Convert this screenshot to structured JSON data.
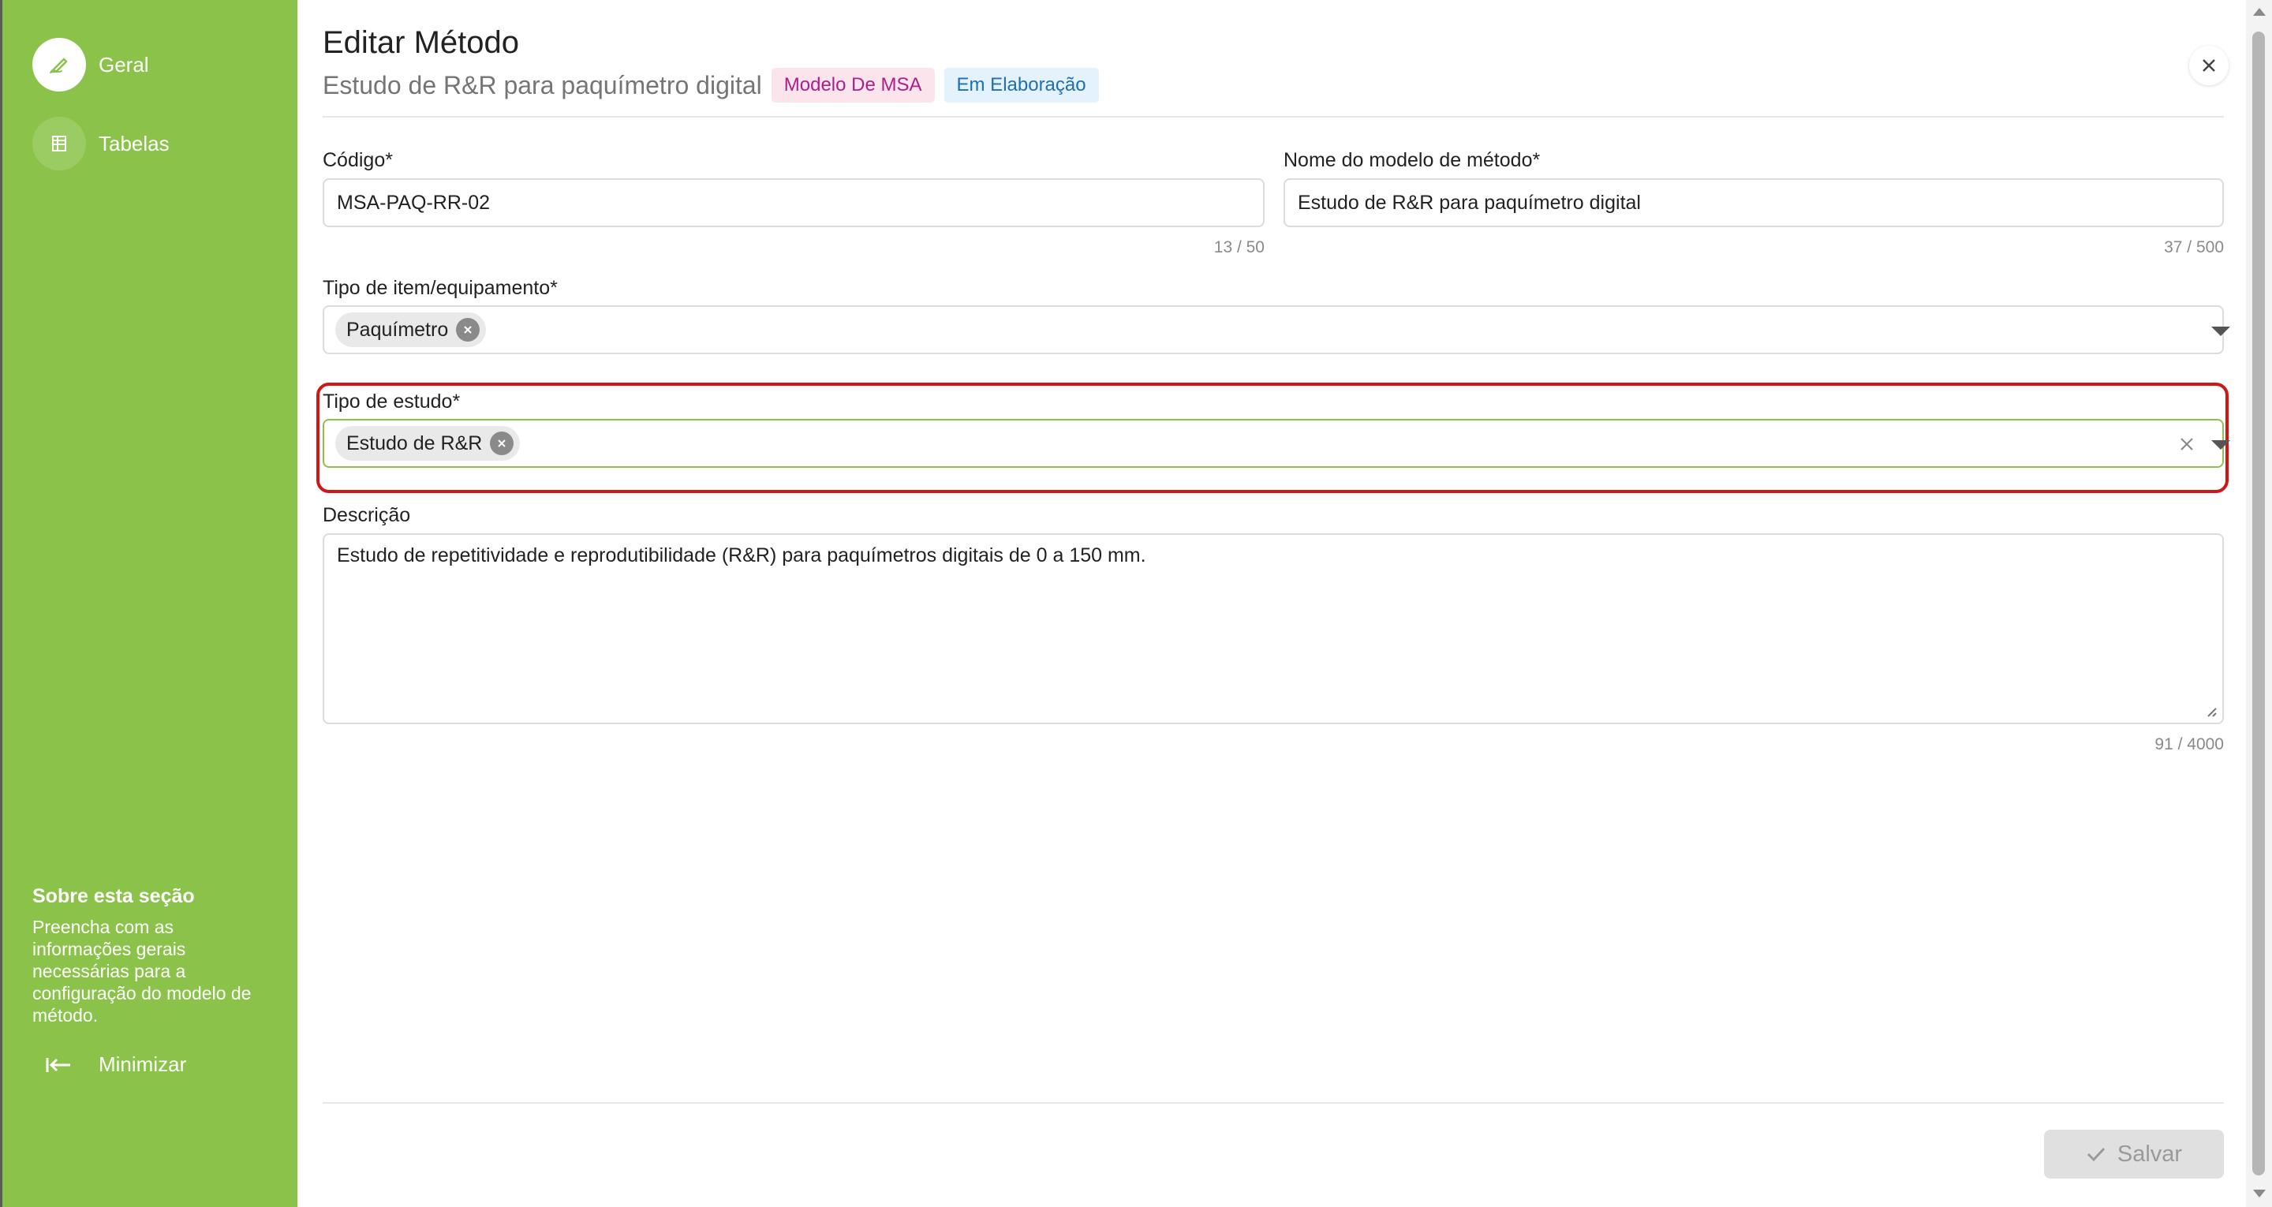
{
  "sidebar": {
    "items": [
      {
        "label": "Geral",
        "icon": "pencil-icon",
        "active": true
      },
      {
        "label": "Tabelas",
        "icon": "table-icon",
        "active": false
      }
    ],
    "about_title": "Sobre esta seção",
    "about_text": "Preencha com as informações gerais necessárias para a configuração do modelo de método.",
    "minimize_label": "Minimizar"
  },
  "header": {
    "title": "Editar Método",
    "subtitle": "Estudo de R&R para paquímetro digital",
    "badges": [
      {
        "label": "Modelo De MSA",
        "color": "#ad1f8a"
      },
      {
        "label": "Em Elaboração",
        "color": "#1f6fb2"
      }
    ]
  },
  "form": {
    "codigo": {
      "label": "Código*",
      "value": "MSA-PAQ-RR-02",
      "counter": "13 / 50"
    },
    "nome": {
      "label": "Nome do modelo de método*",
      "value": "Estudo de R&R para paquímetro digital",
      "counter": "37 / 500"
    },
    "tipo_item": {
      "label": "Tipo de item/equipamento*",
      "chip": "Paquímetro"
    },
    "tipo_estudo": {
      "label": "Tipo de estudo*",
      "chip": "Estudo de R&R"
    },
    "descricao": {
      "label": "Descrição",
      "value": "Estudo de repetitividade e reprodutibilidade (R&R) para paquímetros digitais de 0 a 150 mm.",
      "counter": "91 / 4000"
    }
  },
  "footer": {
    "save_label": "Salvar"
  },
  "colors": {
    "sidebar_bg": "#8bc34a",
    "highlight": "#d01616",
    "active_input_border": "#8bc34a"
  }
}
